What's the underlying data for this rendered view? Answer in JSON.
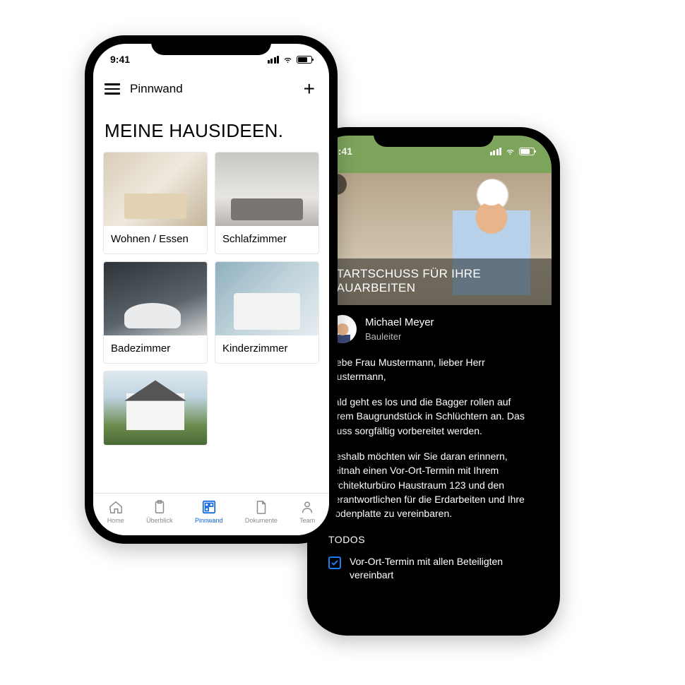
{
  "status": {
    "time": "9:41"
  },
  "screen1": {
    "nav_title": "Pinnwand",
    "page_title": "MEINE HAUSIDEEN.",
    "cards": [
      {
        "label": "Wohnen / Essen"
      },
      {
        "label": "Schlafzimmer"
      },
      {
        "label": "Badezimmer"
      },
      {
        "label": "Kinderzimmer"
      }
    ],
    "tabs": [
      {
        "label": "Home"
      },
      {
        "label": "Überblick"
      },
      {
        "label": "Pinnwand"
      },
      {
        "label": "Dokumente"
      },
      {
        "label": "Team"
      }
    ]
  },
  "screen2": {
    "hero_title": "STARTSCHUSS FÜR IHRE BAUARBEITEN",
    "author": {
      "name": "Michael Meyer",
      "role": "Bauleiter"
    },
    "p1": "Liebe Frau Mustermann, lieber Herr Mustermann,",
    "p2": "bald geht es los und die Bagger rollen auf Ihrem Baugrundstück in Schlüchtern an. Das muss sorgfältig vorbereitet werden.",
    "p3": "Deshalb möchten wir Sie daran erinnern, zeitnah einen Vor-Ort-Termin mit Ihrem Architekturbüro Haustraum 123 und den Verantwortlichen für die Erdarbeiten und Ihre Bodenplatte zu vereinbaren.",
    "todos_label": "TODOS",
    "todo1": "Vor-Ort-Termin mit allen Beteiligten vereinbart"
  }
}
